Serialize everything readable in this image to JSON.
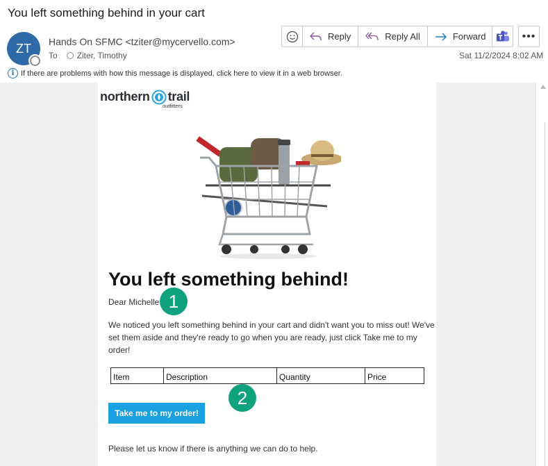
{
  "message": {
    "subject": "You left something behind in your cart",
    "avatar_initials": "ZT",
    "sender": "Hands On SFMC <tziter@mycervello.com>",
    "to_label": "To",
    "recipient": "Ziter, Timothy",
    "date": "Sat 11/2/2024 8:02 AM",
    "info_text": "If there are problems with how this message is displayed, click here to view it in a web browser."
  },
  "toolbar": {
    "reply_label": "Reply",
    "reply_all_label": "Reply All",
    "forward_label": "Forward",
    "more_label": "•••"
  },
  "email": {
    "logo_northern": "northern",
    "logo_trail": "trail",
    "logo_outfitters": "outfitters",
    "headline": "You left something behind!",
    "greeting": "Dear Michelle",
    "paragraph": "We noticed you left something behind in your cart and didn't want you to miss out! We've set them aside and they're ready to go when you are ready, just click Take me to my order!",
    "table_headers": [
      "Item",
      "Description",
      "Quantity",
      "Price"
    ],
    "cta_label": "Take me to my order!",
    "closing": "Please let us know if there is anything we can do to help."
  },
  "annotations": {
    "badge_1": "1",
    "badge_2": "2"
  },
  "colors": {
    "avatar": "#2e6aa8",
    "cta": "#1aa1e1",
    "badge": "#10a27f",
    "teams": "#4b53bc",
    "reply_icon": "#8a56a3",
    "forward_icon": "#1a73b8"
  }
}
